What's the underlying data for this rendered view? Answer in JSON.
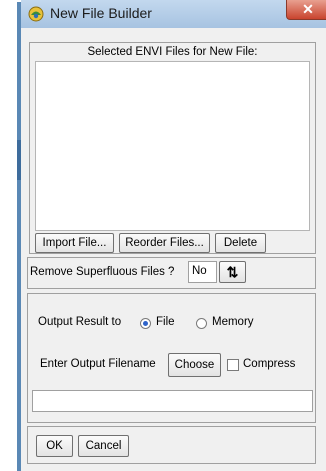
{
  "window": {
    "title": "New File Builder",
    "close_glyph": "✕",
    "icon": "envi-app-icon"
  },
  "files": {
    "header": "Selected ENVI Files for New File:",
    "items": [],
    "import_label": "Import File...",
    "reorder_label": "Reorder Files...",
    "delete_label": "Delete"
  },
  "superfluous": {
    "label": "Remove Superfluous Files ?",
    "value": "No",
    "toggle_icon": "toggle-arrows-icon",
    "toggle_glyph": "⇅"
  },
  "output": {
    "label": "Output Result to",
    "options": [
      {
        "label": "File",
        "selected": true
      },
      {
        "label": "Memory",
        "selected": false
      }
    ],
    "filename_label": "Enter Output Filename",
    "choose_label": "Choose",
    "compress_label": "Compress",
    "compress_checked": false,
    "filename_value": ""
  },
  "footer": {
    "ok_label": "OK",
    "cancel_label": "Cancel"
  }
}
